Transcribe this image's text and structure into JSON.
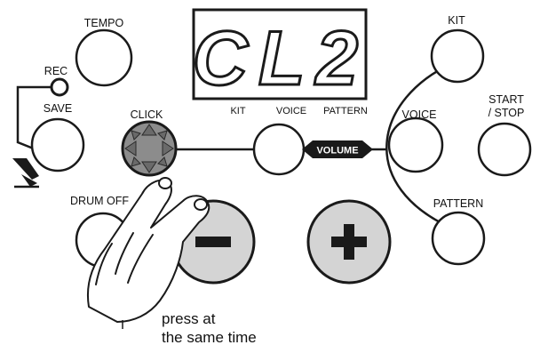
{
  "display": {
    "readout": "CL2"
  },
  "display_labels": {
    "kit": "KIT",
    "voice": "VOICE",
    "pattern": "PATTERN"
  },
  "buttons": {
    "tempo": "TEMPO",
    "rec": "REC",
    "save": "SAVE",
    "click": "CLICK",
    "drum_off": "DRUM OFF",
    "kit": "KIT",
    "voice": "VOICE",
    "start_stop_line1": "START",
    "start_stop_line2": "/ STOP",
    "pattern": "PATTERN",
    "minus": "−",
    "plus": "+"
  },
  "volume_label": "VOLUME",
  "instruction": {
    "line1": "press at",
    "line2": "the same time"
  },
  "colors": {
    "outline": "#1a1a1a",
    "big_button_fill": "#d4d4d4",
    "pressed_button_fill": "#8c8c8c",
    "volume_badge": "#1a1a1a",
    "press_arrows": "#5a5a5a"
  }
}
